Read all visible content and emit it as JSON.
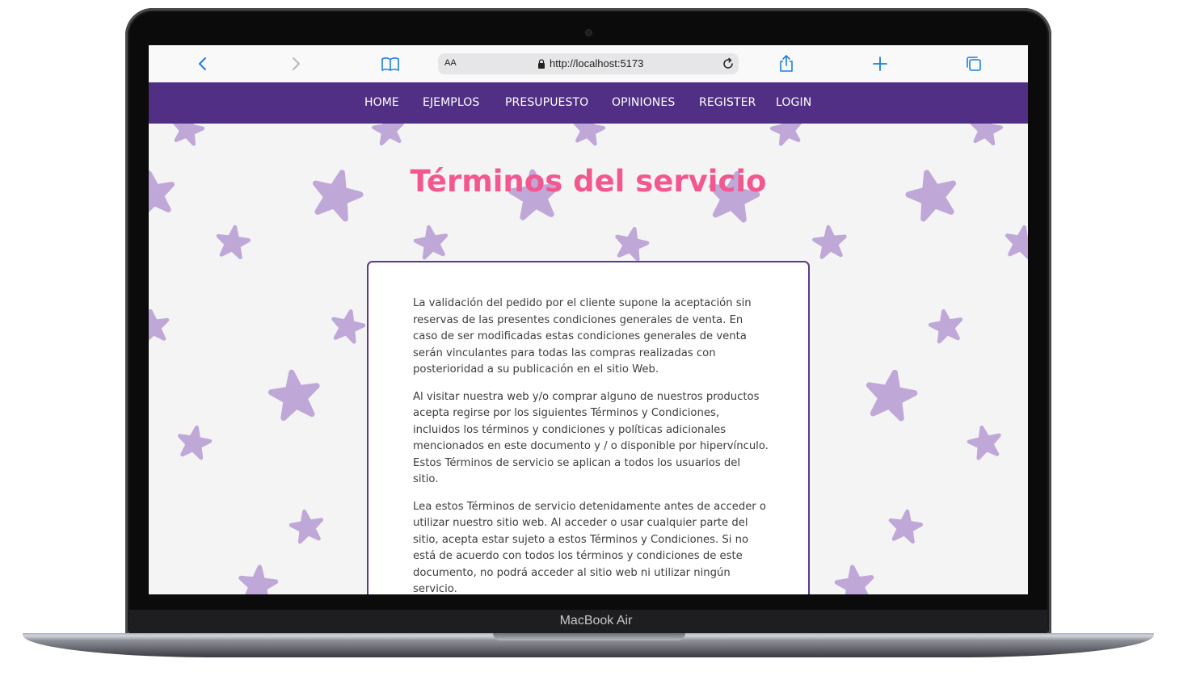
{
  "device": {
    "model_label": "MacBook Air"
  },
  "browser": {
    "text_size_label": "AA",
    "url": "http://localhost:5173",
    "icons": [
      "back-icon",
      "forward-icon",
      "bookmarks-icon",
      "lock-icon",
      "reload-icon",
      "share-icon",
      "new-tab-icon",
      "tabs-icon"
    ]
  },
  "nav": {
    "items": [
      {
        "label": "HOME"
      },
      {
        "label": "EJEMPLOS"
      },
      {
        "label": "PRESUPUESTO"
      },
      {
        "label": "OPINIONES"
      },
      {
        "label": "REGISTER"
      },
      {
        "label": "LOGIN"
      }
    ]
  },
  "page": {
    "title": "Términos del servicio",
    "paragraphs": [
      "La validación del pedido por el cliente supone la aceptación sin reservas de las presentes condiciones generales de venta. En caso de ser modificadas estas condiciones generales de venta serán vinculantes para todas las compras realizadas con posterioridad a su publicación en el sitio Web.",
      "Al visitar nuestra web y/o comprar alguno de nuestros productos acepta regirse por los siguientes Términos y Condiciones, incluidos los términos y condiciones y políticas adicionales mencionados en este documento y / o disponible por hipervínculo. Estos Términos de servicio se aplican a todos los usuarios del sitio.",
      "Lea estos Términos de servicio detenidamente antes de acceder o utilizar nuestro sitio web. Al acceder o usar cualquier parte del sitio, acepta estar sujeto a estos Términos y Condiciones. Si no está de acuerdo con todos los términos y condiciones de este documento, no podrá acceder al sitio web ni utilizar ningún servicio."
    ]
  },
  "colors": {
    "navbar": "#512f85",
    "title": "#f2578f",
    "card_border": "#5a3a8a",
    "stars": "#bfa8d8",
    "page_background": "#f4f4f4",
    "browser_accent": "#1a7fe0"
  }
}
